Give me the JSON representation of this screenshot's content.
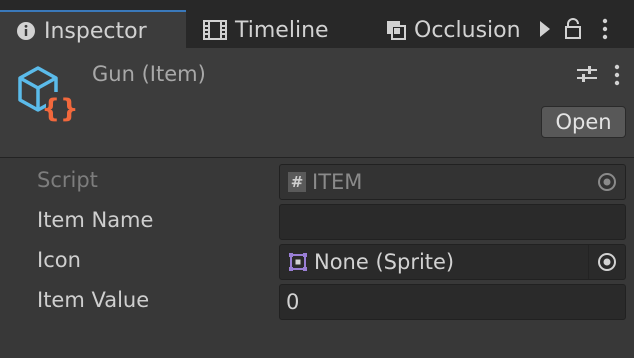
{
  "tabs": [
    {
      "label": "Inspector",
      "icon": "info-icon",
      "active": true
    },
    {
      "label": "Timeline",
      "icon": "film-icon",
      "active": false
    },
    {
      "label": "Occlusion",
      "icon": "occlusion-icon",
      "active": false
    }
  ],
  "toolbar_icons": [
    "play-arrow-icon",
    "lock-icon",
    "kebab-menu-icon"
  ],
  "header": {
    "title": "Gun (Item)",
    "icon": "scriptable-object-icon",
    "open_label": "Open"
  },
  "properties": [
    {
      "label": "Script",
      "value": "ITEM",
      "disabled": true,
      "icon": "hash-icon",
      "picker": true
    },
    {
      "label": "Item Name",
      "value": "",
      "disabled": false,
      "icon": null,
      "picker": false
    },
    {
      "label": "Icon",
      "value": "None (Sprite)",
      "disabled": false,
      "icon": "sprite-icon",
      "picker": true
    },
    {
      "label": "Item Value",
      "value": "0",
      "disabled": false,
      "icon": null,
      "picker": false
    }
  ],
  "colors": {
    "accent_tab": "#3a79bb",
    "background": "#383838",
    "field": "#2a2a2a",
    "icon_blue": "#5bbbea",
    "icon_orange": "#f2683c",
    "sprite_purple": "#9a7fd6"
  }
}
